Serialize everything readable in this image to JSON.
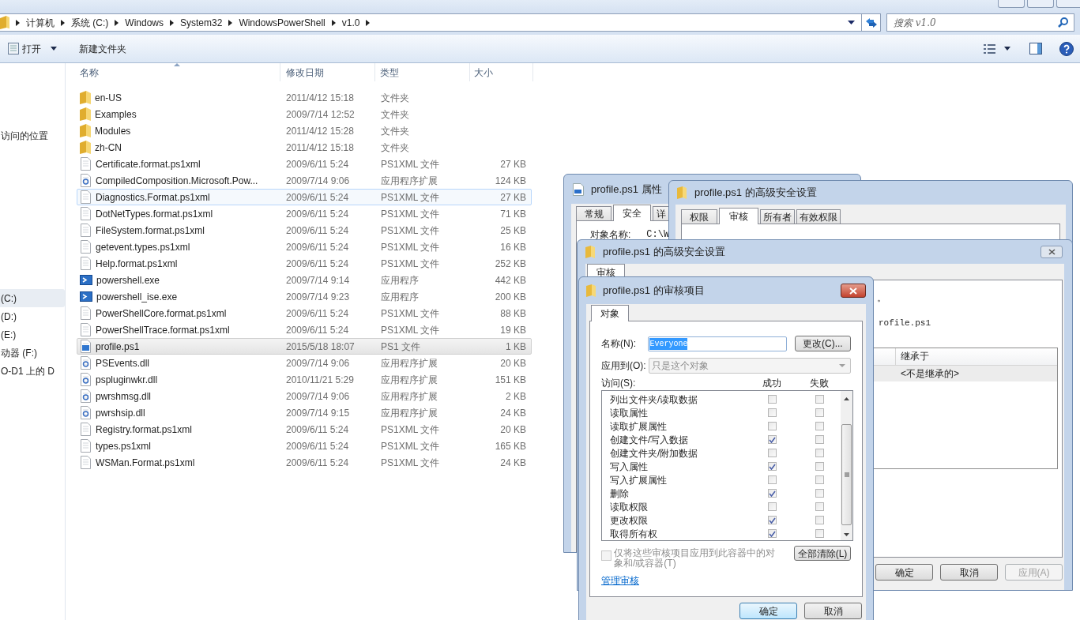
{
  "explorer": {
    "breadcrumb": [
      "计算机",
      "系统 (C:)",
      "Windows",
      "System32",
      "WindowsPowerShell",
      "v1.0"
    ],
    "search": {
      "placeholder": "搜索 v1.0"
    },
    "toolbar": [
      {
        "label": "打开",
        "kind": "menu"
      },
      {
        "label": "新建文件夹",
        "kind": "plain"
      }
    ],
    "sidebar": [
      {
        "label": "访问的位置",
        "selected": false
      },
      {
        "label": "(C:)",
        "selected": true
      },
      {
        "label": "(D:)",
        "selected": false
      },
      {
        "label": "(E:)",
        "selected": false
      },
      {
        "label": "动器 (F:)",
        "selected": false
      },
      {
        "label": "O-D1 上的 D",
        "selected": false
      }
    ],
    "columns": [
      "名称",
      "修改日期",
      "类型",
      "大小"
    ],
    "files": [
      {
        "kind": "folder",
        "name": "en-US",
        "date": "2011/4/12 15:18",
        "type": "文件夹",
        "selected": false,
        "hovered": false
      },
      {
        "kind": "folder",
        "name": "Examples",
        "date": "2009/7/14 12:52",
        "type": "文件夹",
        "selected": false,
        "hovered": false
      },
      {
        "kind": "folder",
        "name": "Modules",
        "date": "2011/4/12 15:28",
        "type": "文件夹",
        "selected": false,
        "hovered": false
      },
      {
        "kind": "folder",
        "name": "zh-CN",
        "date": "2011/4/12 15:18",
        "type": "文件夹",
        "selected": false,
        "hovered": false
      },
      {
        "kind": "file",
        "name": "Certificate.format.ps1xml",
        "date": "2009/6/11 5:24",
        "type": "PS1XML 文件",
        "size": "27 KB",
        "selected": false,
        "hovered": false
      },
      {
        "kind": "dll",
        "name": "CompiledComposition.Microsoft.Pow...",
        "date": "2009/7/14 9:06",
        "type": "应用程序扩展",
        "size": "124 KB",
        "selected": false,
        "hovered": false
      },
      {
        "kind": "file",
        "name": "Diagnostics.Format.ps1xml",
        "date": "2009/6/11 5:24",
        "type": "PS1XML 文件",
        "size": "27 KB",
        "selected": false,
        "hovered": true
      },
      {
        "kind": "file",
        "name": "DotNetTypes.format.ps1xml",
        "date": "2009/6/11 5:24",
        "type": "PS1XML 文件",
        "size": "71 KB",
        "selected": false,
        "hovered": false
      },
      {
        "kind": "file",
        "name": "FileSystem.format.ps1xml",
        "date": "2009/6/11 5:24",
        "type": "PS1XML 文件",
        "size": "25 KB",
        "selected": false,
        "hovered": false
      },
      {
        "kind": "file",
        "name": "getevent.types.ps1xml",
        "date": "2009/6/11 5:24",
        "type": "PS1XML 文件",
        "size": "16 KB",
        "selected": false,
        "hovered": false
      },
      {
        "kind": "file",
        "name": "Help.format.ps1xml",
        "date": "2009/6/11 5:24",
        "type": "PS1XML 文件",
        "size": "252 KB",
        "selected": false,
        "hovered": false
      },
      {
        "kind": "exe",
        "name": "powershell.exe",
        "date": "2009/7/14 9:14",
        "type": "应用程序",
        "size": "442 KB",
        "selected": false,
        "hovered": false
      },
      {
        "kind": "exe",
        "name": "powershell_ise.exe",
        "date": "2009/7/14 9:23",
        "type": "应用程序",
        "size": "200 KB",
        "selected": false,
        "hovered": false
      },
      {
        "kind": "file",
        "name": "PowerShellCore.format.ps1xml",
        "date": "2009/6/11 5:24",
        "type": "PS1XML 文件",
        "size": "88 KB",
        "selected": false,
        "hovered": false
      },
      {
        "kind": "file",
        "name": "PowerShellTrace.format.ps1xml",
        "date": "2009/6/11 5:24",
        "type": "PS1XML 文件",
        "size": "19 KB",
        "selected": false,
        "hovered": false
      },
      {
        "kind": "script",
        "name": "profile.ps1",
        "date": "2015/5/18 18:07",
        "type": "PS1 文件",
        "size": "1 KB",
        "selected": true,
        "hovered": false
      },
      {
        "kind": "dll",
        "name": "PSEvents.dll",
        "date": "2009/7/14 9:06",
        "type": "应用程序扩展",
        "size": "20 KB",
        "selected": false,
        "hovered": false
      },
      {
        "kind": "dll",
        "name": "pspluginwkr.dll",
        "date": "2010/11/21 5:29",
        "type": "应用程序扩展",
        "size": "151 KB",
        "selected": false,
        "hovered": false
      },
      {
        "kind": "dll",
        "name": "pwrshmsg.dll",
        "date": "2009/7/14 9:06",
        "type": "应用程序扩展",
        "size": "2 KB",
        "selected": false,
        "hovered": false
      },
      {
        "kind": "dll",
        "name": "pwrshsip.dll",
        "date": "2009/7/14 9:15",
        "type": "应用程序扩展",
        "size": "24 KB",
        "selected": false,
        "hovered": false
      },
      {
        "kind": "file",
        "name": "Registry.format.ps1xml",
        "date": "2009/6/11 5:24",
        "type": "PS1XML 文件",
        "size": "20 KB",
        "selected": false,
        "hovered": false
      },
      {
        "kind": "file",
        "name": "types.ps1xml",
        "date": "2009/6/11 5:24",
        "type": "PS1XML 文件",
        "size": "165 KB",
        "selected": false,
        "hovered": false
      },
      {
        "kind": "file",
        "name": "WSMan.Format.ps1xml",
        "date": "2009/6/11 5:24",
        "type": "PS1XML 文件",
        "size": "24 KB",
        "selected": false,
        "hovered": false
      }
    ]
  },
  "properties_dialog": {
    "title": "profile.ps1 属性",
    "tabs": [
      {
        "label": "常规",
        "selected": false
      },
      {
        "label": "安全",
        "selected": true
      },
      {
        "label": "详",
        "selected": false
      }
    ],
    "object_name_label": "对象名称:",
    "object_name_value": "C:\\W"
  },
  "advanced_security_back": {
    "title": "profile.ps1 的高级安全设置",
    "tabs": [
      {
        "label": "权限",
        "selected": false
      },
      {
        "label": "审核",
        "selected": true
      },
      {
        "label": "所有者",
        "selected": false
      },
      {
        "label": "有效权限",
        "selected": false
      }
    ]
  },
  "advanced_security": {
    "title": "profile.ps1 的高级安全设置",
    "tabs": [
      {
        "label": "审核",
        "selected": true
      }
    ],
    "text_1": "。",
    "text_2": "rofile.ps1",
    "list": {
      "column": "继承于",
      "rows": [
        {
          "inherited_from": "<不是继承的>",
          "selected": true
        }
      ]
    },
    "buttons": [
      {
        "label": "确定",
        "disabled": false
      },
      {
        "label": "取消",
        "disabled": false
      },
      {
        "label": "应用(A)",
        "disabled": true
      }
    ]
  },
  "audit_entry": {
    "title": "profile.ps1 的审核项目",
    "tabs": [
      {
        "label": "对象",
        "selected": true
      }
    ],
    "name_label": "名称(N):",
    "name_value": "Everyone",
    "change_button": "更改(C)...",
    "apply_to_label": "应用到(O):",
    "apply_to": {
      "value": "只是这个对象",
      "disabled": true
    },
    "access_label": "访问(S):",
    "columns": [
      "成功",
      "失败"
    ],
    "permissions": [
      {
        "name": "列出文件夹/读取数据",
        "success": false,
        "failure": false
      },
      {
        "name": "读取属性",
        "success": false,
        "failure": false
      },
      {
        "name": "读取扩展属性",
        "success": false,
        "failure": false
      },
      {
        "name": "创建文件/写入数据",
        "success": true,
        "failure": false
      },
      {
        "name": "创建文件夹/附加数据",
        "success": false,
        "failure": false
      },
      {
        "name": "写入属性",
        "success": true,
        "failure": false
      },
      {
        "name": "写入扩展属性",
        "success": false,
        "failure": false
      },
      {
        "name": "删除",
        "success": true,
        "failure": false
      },
      {
        "name": "读取权限",
        "success": false,
        "failure": false
      },
      {
        "name": "更改权限",
        "success": true,
        "failure": false
      },
      {
        "name": "取得所有权",
        "success": true,
        "failure": false
      }
    ],
    "scope": {
      "label": "仅将这些审核项目应用到此容器中的对象和/或容器(T)",
      "checked": false,
      "disabled": true
    },
    "clear_button": "全部清除(L)",
    "manage_link": "管理审核",
    "buttons": [
      {
        "label": "确定",
        "default": true
      },
      {
        "label": "取消",
        "default": false
      }
    ]
  }
}
